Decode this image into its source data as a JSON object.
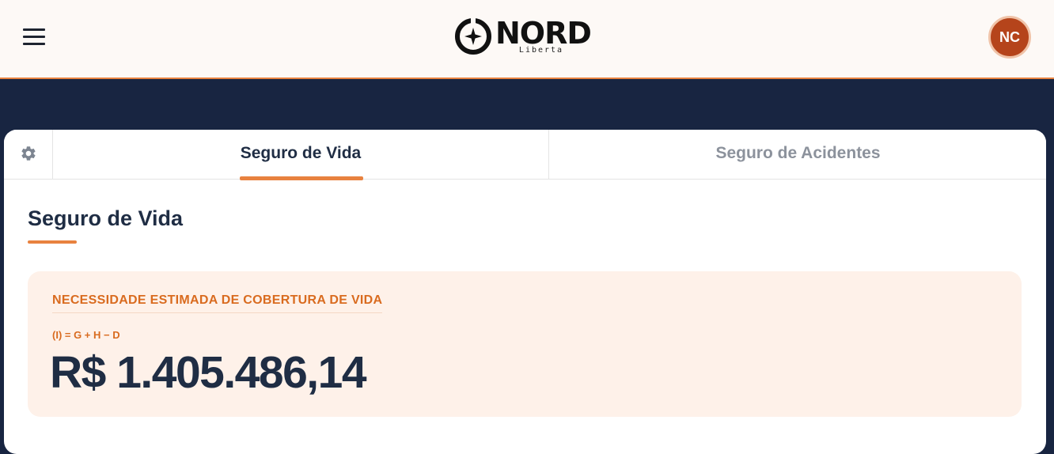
{
  "header": {
    "brand": {
      "name": "NORD",
      "subtitle": "Liberta",
      "color": "#111111"
    },
    "avatar_initials": "NC",
    "accent_color": "#e8823f"
  },
  "tabs": [
    {
      "label": "Seguro de Vida",
      "active": true
    },
    {
      "label": "Seguro de Acidentes",
      "active": false
    }
  ],
  "section": {
    "title": "Seguro de Vida"
  },
  "estimate": {
    "label": "NECESSIDADE ESTIMADA DE COBERTURA DE VIDA",
    "formula": "(I) = G + H − D",
    "value": "R$ 1.405.486,14"
  },
  "icons": {
    "menu": "hamburger-menu-icon",
    "settings": "gear-icon",
    "logo": "compass-star-icon"
  }
}
